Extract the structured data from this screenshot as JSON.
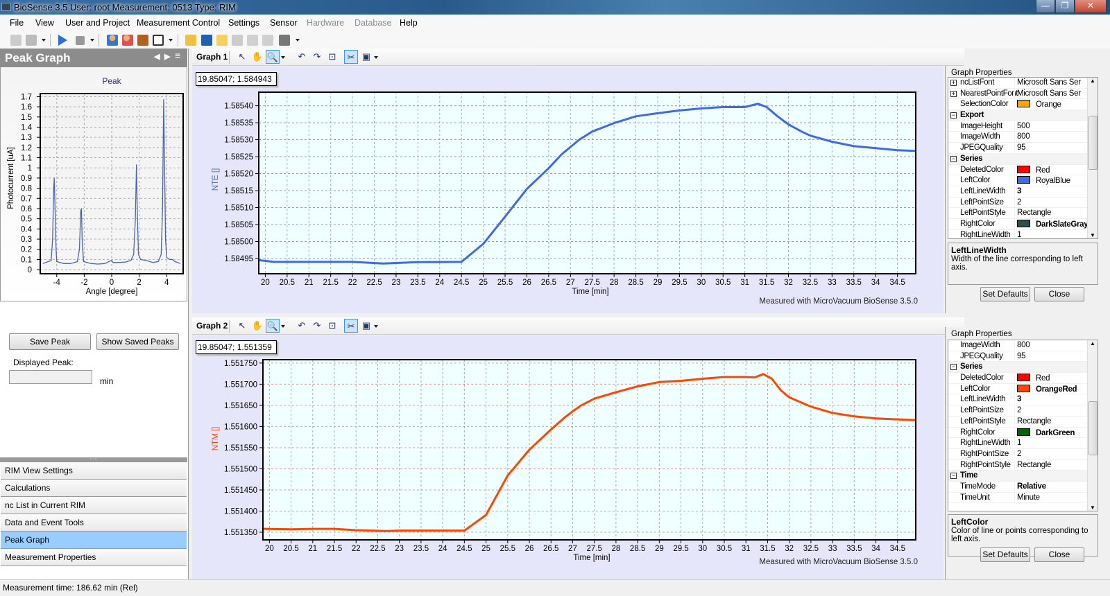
{
  "window": {
    "title": "BioSense 3.5   User: root   Measurement: 0513   Type: RIM",
    "minimize": "—",
    "restore": "❐",
    "close": "✕"
  },
  "menu": [
    "File",
    "View",
    "User and Project",
    "Measurement Control",
    "Settings",
    "Sensor",
    "Hardware",
    "Database",
    "Help"
  ],
  "menu_disabled": [
    "Hardware",
    "Database"
  ],
  "left_panel": {
    "header": "Peak Graph",
    "save_peak": "Save Peak",
    "show_saved_peaks": "Show Saved Peaks",
    "displayed_peak_label": "Displayed Peak:",
    "displayed_peak_value": "",
    "unit": "min",
    "nav": [
      "RIM View Settings",
      "Calculations",
      "nc List in Current RIM",
      "Data and Event Tools",
      "Peak Graph",
      "Measurement Properties"
    ],
    "nav_selected": "Peak Graph"
  },
  "graph1": {
    "label": "Graph 1",
    "coord": "19.85047; 1.584943",
    "footer": "Measured with MicroVacuum BioSense 3.5.0",
    "props_title": "Graph Properties",
    "rows": [
      {
        "exp": "+",
        "name": "ncListFont",
        "value": "Microsoft Sans Ser"
      },
      {
        "exp": "+",
        "name": "NearestPointFont",
        "value": "Microsoft Sans Ser"
      },
      {
        "name": "SelectionColor",
        "value": "Orange",
        "swatch": "#ffa500"
      },
      {
        "exp": "−",
        "name": "Export",
        "section": true
      },
      {
        "name": "ImageHeight",
        "value": "500"
      },
      {
        "name": "ImageWidth",
        "value": "800"
      },
      {
        "name": "JPEGQuality",
        "value": "95"
      },
      {
        "exp": "−",
        "name": "Series",
        "section": true
      },
      {
        "name": "DeletedColor",
        "value": "Red",
        "swatch": "#ff0000"
      },
      {
        "name": "LeftColor",
        "value": "RoyalBlue",
        "swatch": "#4169e1"
      },
      {
        "name": "LeftLineWidth",
        "value": "3",
        "bold": true
      },
      {
        "name": "LeftPointSize",
        "value": "2"
      },
      {
        "name": "LeftPointStyle",
        "value": "Rectangle"
      },
      {
        "name": "RightColor",
        "value": "DarkSlateGray",
        "swatch": "#2f4f4f",
        "bold": true
      },
      {
        "name": "RightLineWidth",
        "value": "1"
      }
    ],
    "desc_title": "LeftLineWidth",
    "desc_text": "Width of the line corresponding to left axis.",
    "set_defaults": "Set Defaults",
    "close": "Close"
  },
  "graph2": {
    "label": "Graph 2",
    "coord": "19.85047; 1.551359",
    "footer": "Measured with MicroVacuum BioSense 3.5.0",
    "props_title": "Graph Properties",
    "rows": [
      {
        "name": "ImageWidth",
        "value": "800"
      },
      {
        "name": "JPEGQuality",
        "value": "95"
      },
      {
        "exp": "−",
        "name": "Series",
        "section": true
      },
      {
        "name": "DeletedColor",
        "value": "Red",
        "swatch": "#ff0000"
      },
      {
        "name": "LeftColor",
        "value": "OrangeRed",
        "swatch": "#ff4500",
        "bold": true
      },
      {
        "name": "LeftLineWidth",
        "value": "3",
        "bold": true
      },
      {
        "name": "LeftPointSize",
        "value": "2"
      },
      {
        "name": "LeftPointStyle",
        "value": "Rectangle"
      },
      {
        "name": "RightColor",
        "value": "DarkGreen",
        "swatch": "#006400",
        "bold": true
      },
      {
        "name": "RightLineWidth",
        "value": "1"
      },
      {
        "name": "RightPointSize",
        "value": "2"
      },
      {
        "name": "RightPointStyle",
        "value": "Rectangle"
      },
      {
        "exp": "−",
        "name": "Time",
        "section": true
      },
      {
        "name": "TimeMode",
        "value": "Relative",
        "bold": true
      },
      {
        "name": "TimeUnit",
        "value": "Minute"
      }
    ],
    "desc_title": "LeftColor",
    "desc_text": "Color of line or points corresponding to left axis.",
    "set_defaults": "Set Defaults",
    "close": "Close"
  },
  "status": "Measurement time: 186.62 min (Rel)",
  "chart_data": [
    {
      "type": "line",
      "title": "Peak",
      "xlabel": "Angle [degree]",
      "ylabel": "Photocurrent [uA]",
      "xlim": [
        -5.2,
        5.2
      ],
      "ylim": [
        -0.04,
        1.73
      ],
      "grid": true,
      "color": "#4a64a8",
      "xticks": [
        -4,
        -2,
        0,
        2,
        4
      ],
      "xtick_labels": [
        "-4",
        "-2",
        "0",
        "2",
        "4"
      ],
      "yticks": [
        0,
        0.1,
        0.2,
        0.3,
        0.4,
        0.5,
        0.6,
        0.7,
        0.8,
        0.9,
        1,
        1.1,
        1.2,
        1.3,
        1.4,
        1.5,
        1.6,
        1.7
      ],
      "ytick_labels": [
        "0",
        "0.1",
        "0.2",
        "0.3",
        "0.4",
        "0.5",
        "0.6",
        "0.7",
        "0.8",
        "0.9",
        "1",
        "1.1",
        "1.2",
        "1.3",
        "1.4",
        "1.5",
        "1.6",
        "1.7"
      ],
      "points": [
        [
          -5,
          0.06
        ],
        [
          -4.8,
          0.07
        ],
        [
          -4.6,
          0.08
        ],
        [
          -4.4,
          0.09
        ],
        [
          -4.3,
          0.3
        ],
        [
          -4.22,
          0.8
        ],
        [
          -4.18,
          0.9
        ],
        [
          -4.12,
          0.6
        ],
        [
          -4.05,
          0.2
        ],
        [
          -4,
          0.08
        ],
        [
          -3.5,
          0.06
        ],
        [
          -3,
          0.06
        ],
        [
          -2.7,
          0.07
        ],
        [
          -2.5,
          0.08
        ],
        [
          -2.35,
          0.2
        ],
        [
          -2.25,
          0.58
        ],
        [
          -2.2,
          0.6
        ],
        [
          -2.15,
          0.3
        ],
        [
          -2.05,
          0.08
        ],
        [
          -1.5,
          0.06
        ],
        [
          -1,
          0.055
        ],
        [
          -0.5,
          0.06
        ],
        [
          -0.2,
          0.08
        ],
        [
          0,
          0.09
        ],
        [
          0.1,
          0.07
        ],
        [
          0.5,
          0.07
        ],
        [
          1,
          0.075
        ],
        [
          1.4,
          0.09
        ],
        [
          1.6,
          0.15
        ],
        [
          1.72,
          0.5
        ],
        [
          1.8,
          1.03
        ],
        [
          1.86,
          0.6
        ],
        [
          1.95,
          0.15
        ],
        [
          2.1,
          0.1
        ],
        [
          2.5,
          0.09
        ],
        [
          3,
          0.07
        ],
        [
          3.4,
          0.08
        ],
        [
          3.6,
          0.15
        ],
        [
          3.7,
          0.6
        ],
        [
          3.78,
          1.67
        ],
        [
          3.84,
          1.1
        ],
        [
          3.92,
          0.3
        ],
        [
          4,
          0.12
        ],
        [
          4.2,
          0.1
        ],
        [
          4.4,
          0.1
        ],
        [
          4.6,
          0.08
        ],
        [
          5,
          0.06
        ]
      ]
    },
    {
      "type": "line",
      "xlabel": "Time [min]",
      "ylabel": "NTE []",
      "xlim": [
        19.85,
        34.92
      ],
      "ylim": [
        1.584905,
        1.58544
      ],
      "grid": true,
      "color": "#4169e1",
      "hgrid_color": "#7f9cf0",
      "xticks": [
        20,
        20.5,
        21,
        21.5,
        22,
        22.5,
        23,
        23.5,
        24,
        24.5,
        25,
        25.5,
        26,
        26.5,
        27,
        27.5,
        28,
        28.5,
        29,
        29.5,
        30,
        30.5,
        31,
        31.5,
        32,
        32.5,
        33,
        33.5,
        34,
        34.5
      ],
      "xtick_labels": [
        "20",
        "20.5",
        "21",
        "21.5",
        "22",
        "22.5",
        "23",
        "23.5",
        "24",
        "24.5",
        "25",
        "25.5",
        "26",
        "26.5",
        "27",
        "27.5",
        "28",
        "28.5",
        "29",
        "29.5",
        "30",
        "30.5",
        "31",
        "31.5",
        "32",
        "32.5",
        "33",
        "33.5",
        "34",
        "34.5"
      ],
      "yticks": [
        1.58495,
        1.585,
        1.58505,
        1.5851,
        1.58515,
        1.5852,
        1.58525,
        1.5853,
        1.58535,
        1.5854
      ],
      "ytick_labels": [
        "1.58495",
        "1.58500",
        "1.58505",
        "1.58510",
        "1.58515",
        "1.58520",
        "1.58525",
        "1.58530",
        "1.58535",
        "1.58540"
      ],
      "points": [
        [
          19.85,
          1.584945
        ],
        [
          20.2,
          1.58494
        ],
        [
          21,
          1.58494
        ],
        [
          22,
          1.58494
        ],
        [
          22.7,
          1.584935
        ],
        [
          23.5,
          1.584939
        ],
        [
          24.5,
          1.58494
        ],
        [
          25,
          1.584993
        ],
        [
          25.5,
          1.585073
        ],
        [
          26,
          1.585155
        ],
        [
          26.5,
          1.585216
        ],
        [
          26.8,
          1.585257
        ],
        [
          27.2,
          1.5853
        ],
        [
          27.5,
          1.585324
        ],
        [
          28,
          1.585349
        ],
        [
          28.5,
          1.585369
        ],
        [
          29,
          1.585378
        ],
        [
          29.5,
          1.585386
        ],
        [
          30,
          1.585392
        ],
        [
          30.5,
          1.585396
        ],
        [
          31,
          1.585396
        ],
        [
          31.3,
          1.585406
        ],
        [
          31.5,
          1.585396
        ],
        [
          31.75,
          1.585369
        ],
        [
          32,
          1.585345
        ],
        [
          32.3,
          1.585324
        ],
        [
          32.5,
          1.585312
        ],
        [
          33,
          1.585294
        ],
        [
          33.5,
          1.585281
        ],
        [
          34,
          1.585275
        ],
        [
          34.5,
          1.585269
        ],
        [
          34.92,
          1.585267
        ]
      ]
    },
    {
      "type": "line",
      "xlabel": "Time [min]",
      "ylabel": "NTM []",
      "xlim": [
        19.85,
        34.92
      ],
      "ylim": [
        1.551332,
        1.551758
      ],
      "grid": true,
      "color": "#ff4500",
      "hgrid_color": "#f59a74",
      "xticks": [
        20,
        20.5,
        21,
        21.5,
        22,
        22.5,
        23,
        23.5,
        24,
        24.5,
        25,
        25.5,
        26,
        26.5,
        27,
        27.5,
        28,
        28.5,
        29,
        29.5,
        30,
        30.5,
        31,
        31.5,
        32,
        32.5,
        33,
        33.5,
        34,
        34.5
      ],
      "xtick_labels": [
        "20",
        "20.5",
        "21",
        "21.5",
        "22",
        "22.5",
        "23",
        "23.5",
        "24",
        "24.5",
        "25",
        "25.5",
        "26",
        "26.5",
        "27",
        "27.5",
        "28",
        "28.5",
        "29",
        "29.5",
        "30",
        "30.5",
        "31",
        "31.5",
        "32",
        "32.5",
        "33",
        "33.5",
        "34",
        "34.5"
      ],
      "yticks": [
        1.55135,
        1.5514,
        1.55145,
        1.5515,
        1.55155,
        1.5516,
        1.55165,
        1.5517,
        1.55175
      ],
      "ytick_labels": [
        "1.551350",
        "1.551400",
        "1.551450",
        "1.551500",
        "1.551550",
        "1.551600",
        "1.551650",
        "1.551700",
        "1.551750"
      ],
      "points": [
        [
          19.85,
          1.551358
        ],
        [
          20.5,
          1.551357
        ],
        [
          21,
          1.551358
        ],
        [
          21.5,
          1.551358
        ],
        [
          22,
          1.551355
        ],
        [
          22.7,
          1.551353
        ],
        [
          23,
          1.551354
        ],
        [
          24,
          1.551354
        ],
        [
          24.5,
          1.551354
        ],
        [
          25,
          1.551391
        ],
        [
          25.5,
          1.551484
        ],
        [
          26,
          1.551545
        ],
        [
          26.5,
          1.551593
        ],
        [
          26.8,
          1.55162
        ],
        [
          27,
          1.551636
        ],
        [
          27.2,
          1.55165
        ],
        [
          27.5,
          1.551666
        ],
        [
          28,
          1.551681
        ],
        [
          28.5,
          1.551695
        ],
        [
          29,
          1.551705
        ],
        [
          29.5,
          1.551708
        ],
        [
          30,
          1.551713
        ],
        [
          30.5,
          1.551717
        ],
        [
          31,
          1.551717
        ],
        [
          31.2,
          1.551716
        ],
        [
          31.4,
          1.551724
        ],
        [
          31.6,
          1.551713
        ],
        [
          31.8,
          1.551686
        ],
        [
          32,
          1.551669
        ],
        [
          32.5,
          1.551647
        ],
        [
          33,
          1.551632
        ],
        [
          33.5,
          1.551624
        ],
        [
          34,
          1.551619
        ],
        [
          34.5,
          1.551617
        ],
        [
          34.92,
          1.551615
        ]
      ]
    }
  ]
}
